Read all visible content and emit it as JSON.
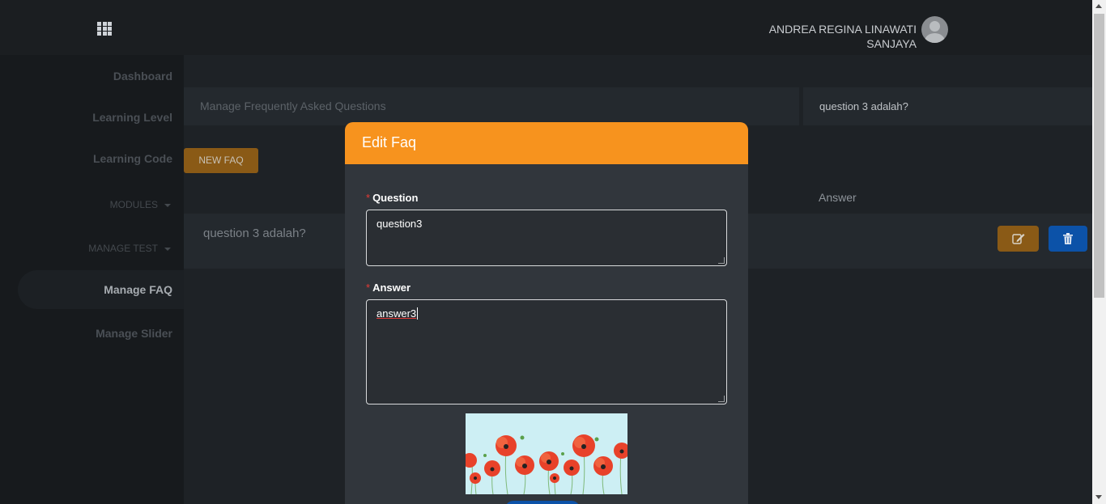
{
  "topbar": {
    "user_name_line1": "ANDREA REGINA LINAWATI",
    "user_name_line2": "SANJAYA"
  },
  "sidebar": {
    "items": [
      {
        "label": "Dashboard"
      },
      {
        "label": "Learning Level"
      },
      {
        "label": "Learning Code"
      },
      {
        "label": "MODULES"
      },
      {
        "label": "MANAGE TEST"
      },
      {
        "label": "Manage FAQ"
      },
      {
        "label": "Manage Slider"
      }
    ]
  },
  "main": {
    "breadcrumb": "Manage Frequently Asked Questions",
    "search_value": "question 3 adalah?",
    "new_button": "NEW FAQ",
    "table": {
      "header_answer": "Answer",
      "rows": [
        {
          "question": "question 3 adalah?"
        }
      ]
    }
  },
  "modal": {
    "title": "Edit Faq",
    "question_label": "Question",
    "question_value": "question3",
    "answer_label": "Answer",
    "answer_value": "answer3",
    "required_mark": "*"
  },
  "colors": {
    "accent": "#f7931e",
    "edit_button": "#8a5a16",
    "delete_button": "#0c52a8"
  }
}
